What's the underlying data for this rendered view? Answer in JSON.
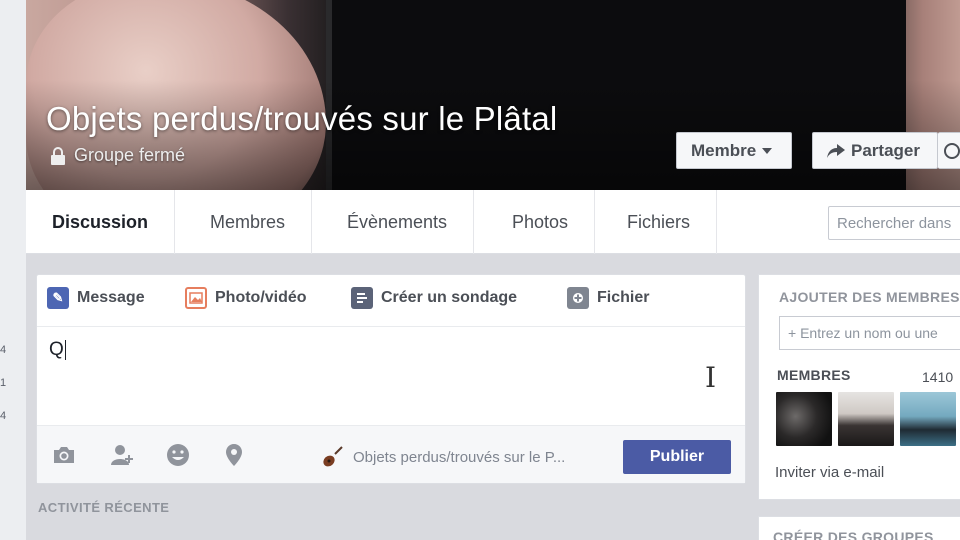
{
  "gutter_numbers": [
    "4",
    "1",
    "4"
  ],
  "cover": {
    "title": "Objets perdus/trouvés sur le Plâtal",
    "privacy": "Groupe fermé",
    "member_button": "Membre",
    "share_button": "Partager"
  },
  "nav": {
    "tabs": [
      "Discussion",
      "Membres",
      "Évènements",
      "Photos",
      "Fichiers"
    ],
    "search_placeholder": "Rechercher dans"
  },
  "composer": {
    "tabs": [
      "Message",
      "Photo/vidéo",
      "Créer un sondage",
      "Fichier"
    ],
    "input_value": "Q",
    "audience": "Objets perdus/trouvés sur le P...",
    "publish": "Publier"
  },
  "recent_activity": "ACTIVITÉ RÉCENTE",
  "sidebar": {
    "add_members_title": "AJOUTER DES MEMBRES",
    "add_members_placeholder": "+ Entrez un nom ou une",
    "members_label": "MEMBRES",
    "members_count": "1410",
    "invite": "Inviter via e-mail",
    "create_groups_title": "CRÉER DES GROUPES"
  },
  "colors": {
    "publish_button": "#4b5ba5",
    "message_icon": "#4d66b3",
    "photo_icon": "#e67e5e",
    "poll_icon": "#5b6378",
    "file_icon": "#7f8590"
  }
}
